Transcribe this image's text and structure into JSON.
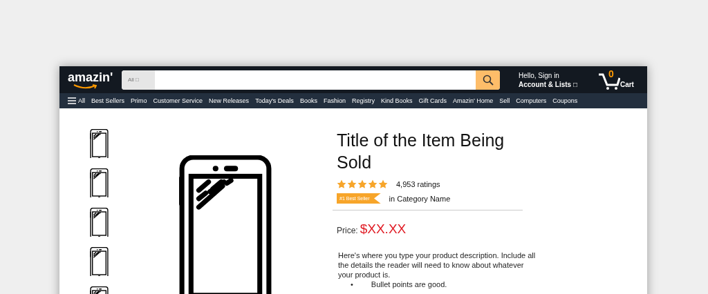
{
  "header": {
    "logo": "amazin'",
    "search": {
      "category": "All □"
    },
    "greeting": "Hello, Sign in",
    "account": "Account & Lists □",
    "cart_count": "0",
    "cart_label": "Cart"
  },
  "nav": {
    "menu_label": "All",
    "links": [
      "Best Sellers",
      "Primo",
      "Customer Service",
      "New Releases",
      "Today's Deals",
      "Books",
      "Fashion",
      "Registry",
      "Kind Books",
      "Gift Cards",
      "Amazin' Home",
      "Sell",
      "Computers",
      "Coupons"
    ]
  },
  "product": {
    "title": "Title of the Item Being Sold",
    "stars": 5,
    "ratings": "4,953 ratings",
    "badge": "#1 Best Seller",
    "category": "in Category Name",
    "price_label": "Price:",
    "price": "$XX.XX",
    "description": "Here's where you type your product description. Include all the details the reader will need to know about whatever your product is.",
    "bullets": [
      {
        "marker": "•",
        "text": "Bullet points are good."
      }
    ]
  }
}
